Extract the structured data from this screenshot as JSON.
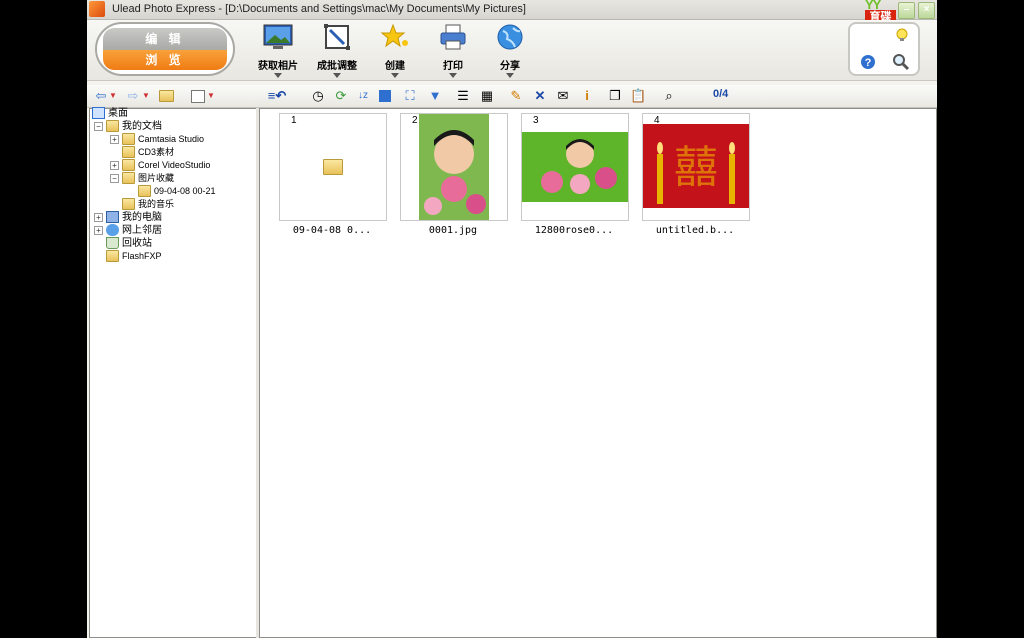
{
  "window": {
    "title": "Ulead Photo Express - [D:\\Documents and Settings\\mac\\My Documents\\My Pictures]",
    "logo_top": "YY",
    "logo_text": "育碟软件"
  },
  "mode": {
    "edit": "编 辑",
    "browse": "浏 览"
  },
  "toolbar": {
    "get_photos": "获取相片",
    "batch_adjust": "成批调整",
    "create": "创建",
    "print": "打印",
    "share": "分享"
  },
  "subtoolbar": {
    "counter": "0/4"
  },
  "tree": {
    "desktop": "桌面",
    "my_documents": "我的文档",
    "camtasia": "Camtasia Studio",
    "cd3": "CD3素材",
    "corel": "Corel VideoStudio",
    "pictures": "图片收藏",
    "pic_folder": "09-04-08 00-21",
    "music": "我的音乐",
    "my_computer": "我的电脑",
    "network": "网上邻居",
    "recycle": "回收站",
    "flashfxp": "FlashFXP"
  },
  "thumbnails": [
    {
      "num": "1",
      "caption": "09-04-08 0..."
    },
    {
      "num": "2",
      "caption": "0001.jpg"
    },
    {
      "num": "3",
      "caption": "12800rose0..."
    },
    {
      "num": "4",
      "caption": "untitled.b..."
    }
  ],
  "colors": {
    "accent": "#f07b14",
    "counter": "#1b49a8"
  }
}
